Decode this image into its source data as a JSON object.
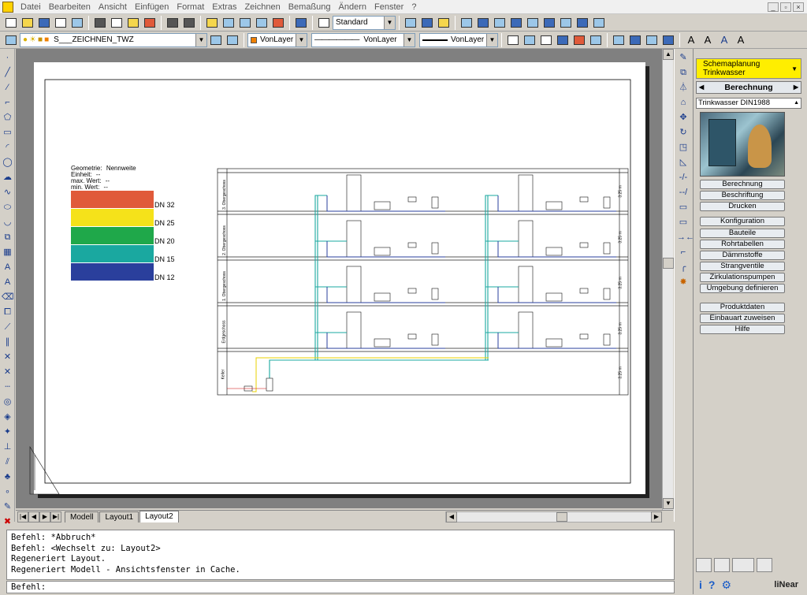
{
  "menu": [
    "Datei",
    "Bearbeiten",
    "Ansicht",
    "Einfügen",
    "Format",
    "Extras",
    "Zeichnen",
    "Bemaßung",
    "Ändern",
    "Fenster",
    "?"
  ],
  "toolbar1": {
    "style_combo": "Standard"
  },
  "toolbar2": {
    "layer_combo": "S___ZEICHNEN_TWZ",
    "color_combo": "VonLayer",
    "linetype_combo": "VonLayer",
    "lineweight_combo": "VonLayer"
  },
  "layout_tabs": [
    "Modell",
    "Layout1",
    "Layout2"
  ],
  "command_history": [
    "Befehl: *Abbruch*",
    "Befehl:  <Wechselt zu: Layout2>",
    "Regeneriert Layout.",
    "Regeneriert Modell - Ansichtsfenster in Cache."
  ],
  "command_prompt": "Befehl:",
  "legend": {
    "geometry_label": "Geometrie:",
    "geometry_value": "Nennweite",
    "unit_label": "Einheit:",
    "unit_value": "--",
    "max_label": "max. Wert:",
    "max_value": "--",
    "min_label": "min. Wert:",
    "min_value": "--",
    "entries": [
      {
        "label": "DN  32",
        "color": "#e05a3a"
      },
      {
        "label": "DN  25",
        "color": "#f5e21a"
      },
      {
        "label": "DN  20",
        "color": "#1fa84a"
      },
      {
        "label": "DN  15",
        "color": "#1aa8a0"
      },
      {
        "label": "DN  12",
        "color": "#2a3f9c"
      }
    ]
  },
  "floors": [
    {
      "name": "3. Obergeschoss",
      "height": "3.25 m"
    },
    {
      "name": "2. Obergeschoss",
      "height": "3.25 m"
    },
    {
      "name": "1. Obergeschoss",
      "height": "3.25 m"
    },
    {
      "name": "Erdgeschoss",
      "height": "3.25 m"
    },
    {
      "name": "Keller",
      "height": "3.25 m"
    }
  ],
  "panel": {
    "dropdown": "Schemaplanung Trinkwasser",
    "section": "Berechnung",
    "norm": "Trinkwasser DIN1988",
    "group1": [
      "Berechnung",
      "Beschriftung",
      "Drucken"
    ],
    "group2": [
      "Konfiguration",
      "Bauteile",
      "Rohrtabellen",
      "Dämmstoffe",
      "Strangventile",
      "Zirkulationspumpen",
      "Umgebung definieren"
    ],
    "group3": [
      "Produktdaten",
      "Einbauart zuweisen",
      "Hilfe"
    ],
    "logo": "liNear"
  }
}
